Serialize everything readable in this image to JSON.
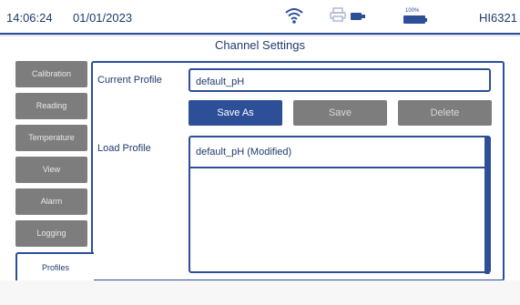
{
  "status": {
    "time": "14:06:24",
    "date": "01/01/2023",
    "battery_pct": "100%",
    "meter": "HI6321",
    "icons": [
      "wifi-icon",
      "printer-icon",
      "usb-icon",
      "battery-icon"
    ]
  },
  "title": "Channel Settings",
  "tabs": [
    {
      "label": "Calibration"
    },
    {
      "label": "Reading"
    },
    {
      "label": "Temperature"
    },
    {
      "label": "View"
    },
    {
      "label": "Alarm"
    },
    {
      "label": "Logging"
    },
    {
      "label": "Profiles"
    }
  ],
  "active_tab": "Profiles",
  "current_profile": {
    "label": "Current Profile",
    "value": "default_pH"
  },
  "buttons": {
    "save_as": "Save As",
    "save": "Save",
    "delete": "Delete"
  },
  "load_profile": {
    "label": "Load Profile",
    "items": [
      "default_pH (Modified)"
    ]
  },
  "colors": {
    "accent": "#2c4f98",
    "disabled": "#7d7d7d",
    "text": "#1f3a6e"
  }
}
